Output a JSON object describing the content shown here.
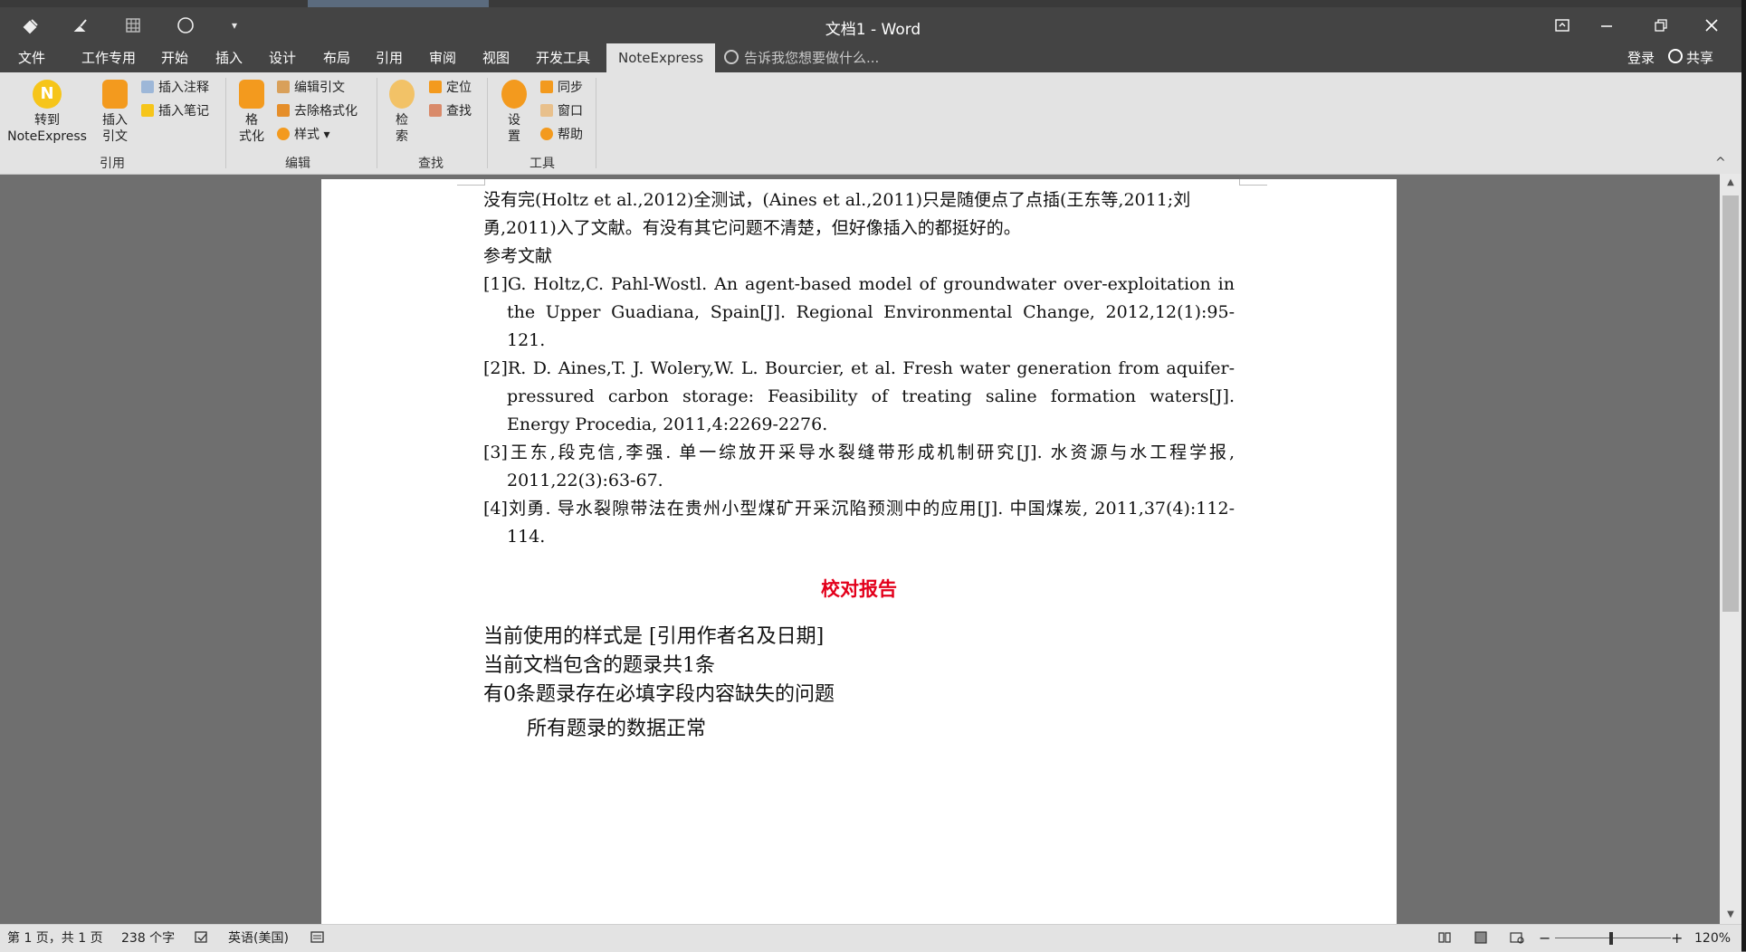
{
  "window": {
    "title": "文档1 - Word",
    "quick_access": [
      "save-icon",
      "brush-icon",
      "table-icon",
      "circle-icon",
      "dropdown-icon"
    ],
    "controls": [
      "ribbon-display-icon",
      "minimize-icon",
      "restore-icon",
      "close-icon"
    ]
  },
  "tabs": [
    "文件",
    "工作专用",
    "开始",
    "插入",
    "设计",
    "布局",
    "引用",
    "审阅",
    "视图",
    "开发工具",
    "NoteExpress"
  ],
  "active_tab": "NoteExpress",
  "tellme": "告诉我您想要做什么...",
  "account": {
    "login": "登录",
    "share": "共享"
  },
  "ribbon": {
    "groups": {
      "cite": "引用",
      "edit": "编辑",
      "find": "查找",
      "tools": "工具"
    },
    "goto_line1": "转到",
    "goto_line2": "NoteExpress",
    "insert_cite_line1": "插入",
    "insert_cite_line2": "引文",
    "insert_note": "插入注释",
    "insert_memo": "插入笔记",
    "format_line1": "格",
    "format_line2": "式化",
    "edit_cite": "编辑引文",
    "remove_format": "去除格式化",
    "style": "样式",
    "search_line1": "检",
    "search_line2": "索",
    "locate": "定位",
    "find": "查找",
    "settings_line1": "设",
    "settings_line2": "置",
    "sync": "同步",
    "window": "窗口",
    "help": "帮助",
    "collapse": "^",
    "colors": {
      "orange": "#f39a1e",
      "yellow": "#f6c51a",
      "ribbon_bg": "#e3e3e3"
    }
  },
  "document": {
    "body_text": "没有完(Holtz et al.,2012)全测试，(Aines et al.,2011)只是随便点了点插(王东等,2011;刘勇,2011)入了文献。有没有其它问题不清楚，但好像插入的都挺好的。",
    "refs_heading": "参考文献",
    "references": [
      "[1]G. Holtz,C. Pahl-Wostl. An agent-based model of groundwater over-exploitation in the Upper Guadiana, Spain[J]. Regional Environmental Change, 2012,12(1):95-121.",
      "[2]R. D. Aines,T. J. Wolery,W. L. Bourcier, et al. Fresh water generation from aquifer-pressured carbon storage: Feasibility of treating saline formation waters[J]. Energy Procedia, 2011,4:2269-2276.",
      "[3]王东,段克信,李强. 单一综放开采导水裂缝带形成机制研究[J]. 水资源与水工程学报, 2011,22(3):63-67.",
      "[4]刘勇. 导水裂隙带法在贵州小型煤矿开采沉陷预测中的应用[J]. 中国煤炭, 2011,37(4):112-114."
    ],
    "report_title": "校对报告",
    "report_lines": [
      "当前使用的样式是 [引用作者名及日期]",
      "当前文档包含的题录共1条",
      "有0条题录存在必填字段内容缺失的问题"
    ],
    "report_ok": "所有题录的数据正常",
    "accent_color": "#e3001b"
  },
  "status": {
    "page": "第 1 页，共 1 页",
    "words": "238 个字",
    "language": "英语(美国)",
    "zoom": "120%",
    "zoom_minus": "−",
    "zoom_plus": "+"
  }
}
